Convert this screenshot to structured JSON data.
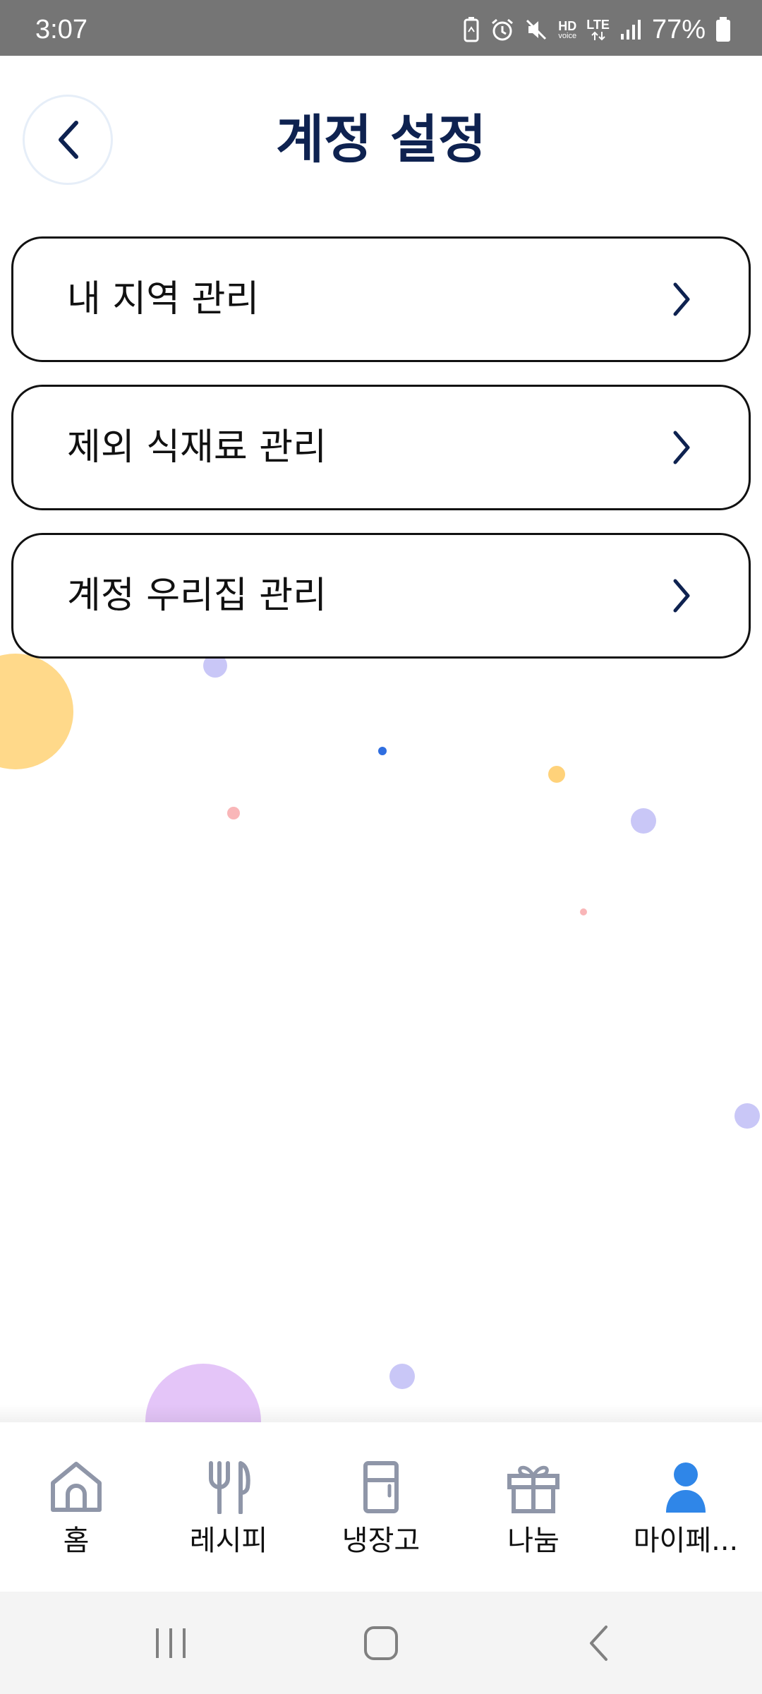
{
  "status_bar": {
    "time": "3:07",
    "battery_percent": "77%",
    "hd_label": "HD",
    "hd_sub": "voice",
    "lte_label": "LTE"
  },
  "header": {
    "title": "계정 설정"
  },
  "menu": {
    "items": [
      {
        "label": "내 지역 관리"
      },
      {
        "label": "제외 식재료 관리"
      },
      {
        "label": "계정 우리집 관리"
      }
    ]
  },
  "bottom_nav": {
    "items": [
      {
        "label": "홈",
        "icon": "home-icon"
      },
      {
        "label": "레시피",
        "icon": "fork-knife-icon"
      },
      {
        "label": "냉장고",
        "icon": "fridge-icon"
      },
      {
        "label": "나눔",
        "icon": "gift-icon"
      },
      {
        "label": "마이페...",
        "icon": "person-icon"
      }
    ],
    "active_index": 4
  },
  "colors": {
    "title": "#0e2250",
    "nav_inactive": "#8f96a8",
    "nav_active": "#2f86e8",
    "status_bar": "#757575"
  }
}
